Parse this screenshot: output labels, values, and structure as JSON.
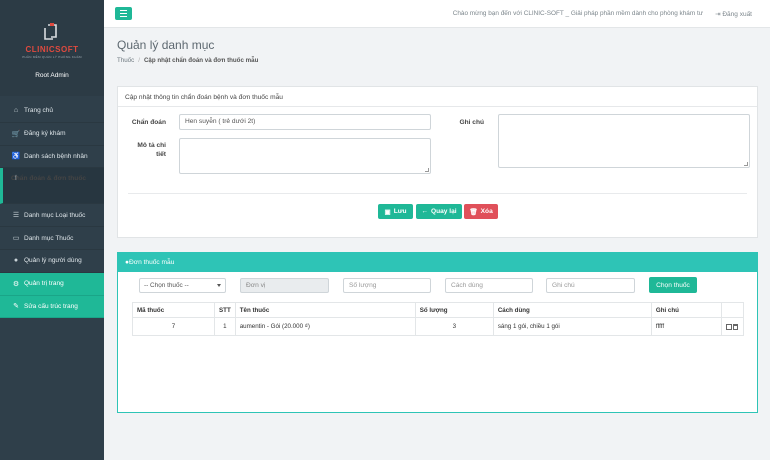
{
  "sidebar": {
    "logo_text": "CLINICSOFT",
    "logo_sub": "PHẦN MỀM QUẢN LÝ PHÒNG KHÁM",
    "user_name": "Root Admin",
    "items": [
      {
        "label": "Trang chủ",
        "icon": "home-icon"
      },
      {
        "label": "Đăng ký khám",
        "icon": "cart-icon"
      },
      {
        "label": "Danh sách bệnh nhân",
        "icon": "wheelchair-icon"
      },
      {
        "label": "Chẩn đoán & đơn thuốc",
        "icon": "stethoscope-icon"
      },
      {
        "label": "Danh mục Loại thuốc",
        "icon": "list-icon"
      },
      {
        "label": "Danh mục Thuốc",
        "icon": "pill-icon"
      },
      {
        "label": "Quản lý người dùng",
        "icon": "user-icon"
      },
      {
        "label": "Quản trị trang",
        "icon": "gear-icon"
      },
      {
        "label": "Sửa cấu trúc trang",
        "icon": "wrench-icon"
      }
    ]
  },
  "topbar": {
    "welcome": "Chào mừng bạn đến với CLINIC-SOFT _ Giải pháp phần mềm dành cho phòng khám tư",
    "logout": "Đăng xuất"
  },
  "page": {
    "title": "Quản lý danh mục",
    "breadcrumb": [
      "Thuốc",
      "Cập nhật chẩn đoán và đơn thuốc mẫu"
    ]
  },
  "form": {
    "panel_title": "Cập nhật thông tin chẩn đoán bệnh và đơn thuốc mẫu",
    "diagnosis_label": "Chẩn đoán",
    "diagnosis_value": "Hen suyễn ( trẻ dưới 2t)",
    "detail_label": "Mô tả chi tiết",
    "detail_value": "",
    "note_label": "Ghi chú",
    "note_value": "",
    "save_label": "Lưu",
    "back_label": "Quay lại",
    "delete_label": "Xóa"
  },
  "prescription": {
    "panel_title": "Đơn thuốc mẫu",
    "drug_select": "-- Chọn thuốc --",
    "unit_placeholder": "Đơn vị",
    "qty_placeholder": "Số lượng",
    "usage_placeholder": "Cách dùng",
    "note_placeholder": "Ghi chú",
    "choose_label": "Chọn thuốc",
    "columns": [
      "Mã thuốc",
      "STT",
      "Tên thuốc",
      "Số lượng",
      "Cách dùng",
      "Ghi chú",
      ""
    ],
    "rows": [
      {
        "code": "7",
        "stt": "1",
        "name": "aumentin - Gói (20.000 ₫)",
        "qty": "3",
        "usage": "sáng 1 gói, chiều 1 gói",
        "note": "fffff"
      }
    ]
  },
  "colors": {
    "accent": "#1fb897",
    "teal_header": "#2ec4b6",
    "danger": "#e0505a",
    "sidebar": "#2f3f4a",
    "logo_red": "#e04a3f"
  }
}
